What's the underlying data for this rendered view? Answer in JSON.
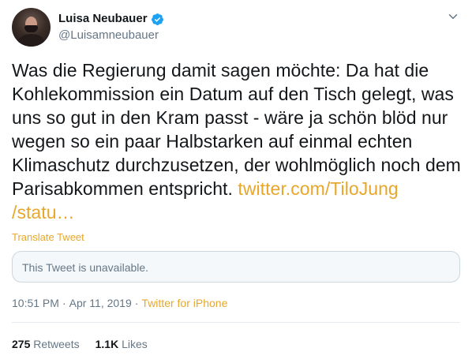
{
  "author": {
    "display_name": "Luisa Neubauer",
    "handle": "@Luisamneubauer",
    "verified": true
  },
  "tweet": {
    "text": "Was die Regierung damit sagen möchte: Da hat die Kohlekommission ein Datum auf den Tisch gelegt, was uns so gut in den Kram passt - wäre ja schön blöd nur wegen so ein paar Halbstarken auf einmal echten Klimaschutz durchzusetzen, der wohlmöglich noch dem Parisabkommen entspricht.",
    "link_line1": "twitter.com/TiloJung",
    "link_line2": "/statu…",
    "translate_label": "Translate Tweet",
    "quoted_unavailable": "This Tweet is unavailable.",
    "time": "10:51 PM",
    "date": "Apr 11, 2019",
    "separator": "·",
    "source": "Twitter for iPhone"
  },
  "stats": {
    "retweets_count": "275",
    "retweets_label": "Retweets",
    "likes_count": "1.1K",
    "likes_label": "Likes"
  },
  "colors": {
    "accent": "#e8a72a",
    "text": "#14171a",
    "secondary": "#657786",
    "verified": "#1da1f2"
  },
  "icons": {
    "verified": "verified-badge-icon",
    "more": "chevron-down-icon"
  }
}
